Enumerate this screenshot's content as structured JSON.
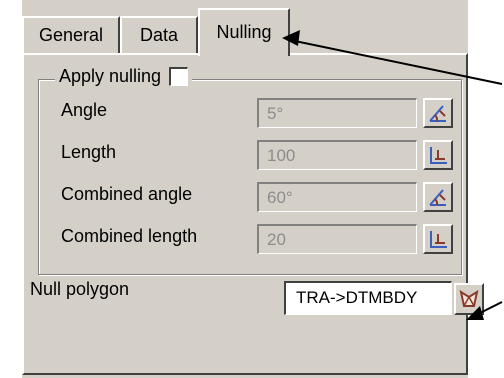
{
  "tabs": [
    {
      "label": "General",
      "active": false
    },
    {
      "label": "Data",
      "active": false
    },
    {
      "label": "Nulling",
      "active": true
    }
  ],
  "group": {
    "label": "Apply nulling",
    "checked": false
  },
  "rows": [
    {
      "label": "Angle",
      "value": "5°",
      "icon": "angle-pick-icon"
    },
    {
      "label": "Length",
      "value": "100",
      "icon": "length-pick-icon"
    },
    {
      "label": "Combined angle",
      "value": "60°",
      "icon": "angle-pick-icon"
    },
    {
      "label": "Combined length",
      "value": "20",
      "icon": "length-pick-icon"
    }
  ],
  "null_polygon": {
    "label": "Null polygon",
    "value": "TRA->DTMBDY",
    "icon": "polygon-pick-icon"
  },
  "colors": {
    "panel": "#d4d0c8",
    "disabled_text": "#8c8c8c",
    "icon_brown": "#8a3a2a",
    "icon_blue": "#3a5fbf"
  }
}
